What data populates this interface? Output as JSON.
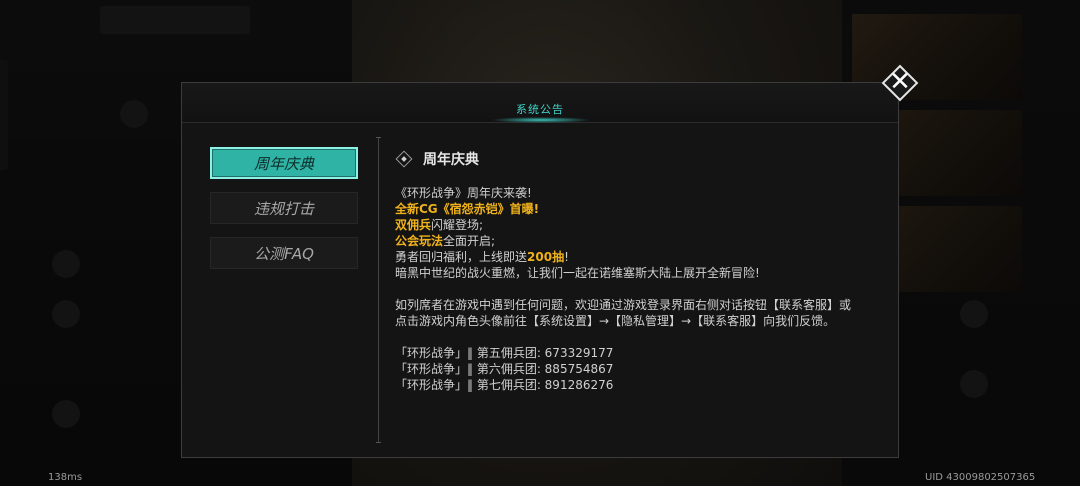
{
  "status": {
    "ping": "138ms",
    "uid": "UID 43009802507365"
  },
  "dialog": {
    "title": "系统公告",
    "close_glyph": "✕",
    "tabs": [
      {
        "label": "周年庆典",
        "active": true
      },
      {
        "label": "违规打击",
        "active": false
      },
      {
        "label": "公测FAQ",
        "active": false
      }
    ],
    "content": {
      "heading": "周年庆典",
      "line1": "《环形战争》周年庆来袭!",
      "line2_gold": "全新CG《宿怨赤铠》首曝!",
      "line3_gold": "双佣兵",
      "line3_rest": "闪耀登场;",
      "line4_gold": "公会玩法",
      "line4_rest": "全面开启;",
      "line5_pre": "勇者回归福利，上线即送",
      "line5_gold": "200抽",
      "line5_post": "!",
      "line6": "暗黑中世纪的战火重燃，让我们一起在诺维塞斯大陆上展开全新冒险!",
      "para2": "如列席者在游戏中遇到任何问题，欢迎通过游戏登录界面右侧对话按钮【联系客服】或点击游戏内角色头像前往【系统设置】→【隐私管理】→【联系客服】向我们反馈。",
      "groups": [
        "「环形战争」‖ 第五佣兵团: 673329177",
        "「环形战争」‖ 第六佣兵团: 885754867",
        "「环形战争」‖ 第七佣兵团: 891286276"
      ]
    }
  },
  "colors": {
    "accent": "#3fd3c9",
    "tab_active": "#2fb3a5",
    "highlight": "#f0b21a"
  },
  "icons": [
    "close-icon",
    "diamond-bullet-icon"
  ]
}
